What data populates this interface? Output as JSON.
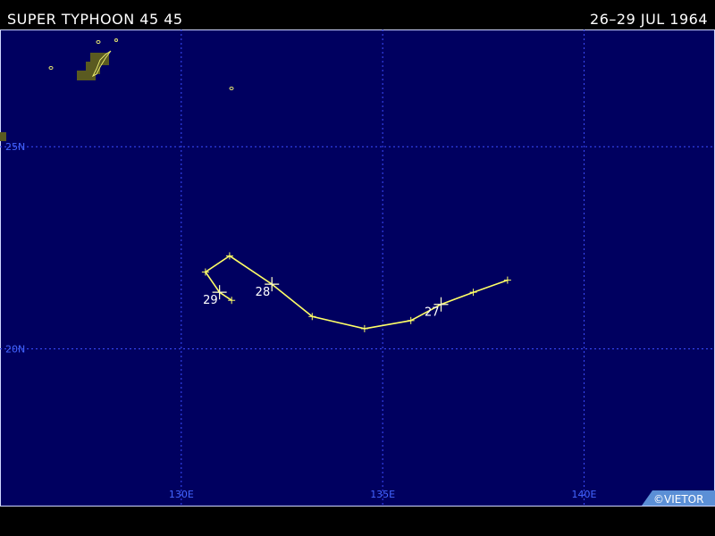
{
  "header": {
    "title": "SUPER TYPHOON 45 45",
    "date_range": "26–29 JUL 1964"
  },
  "map": {
    "background_color": "#000060",
    "grid_color": "#3b4cff",
    "track_color": "#ffff66",
    "land_color": "#5a5a20",
    "lat_range": [
      16.1,
      27.9
    ],
    "lon_range": [
      125.5,
      143.25
    ],
    "meridians": [
      {
        "lon": 130,
        "label": "130E"
      },
      {
        "lon": 135,
        "label": "135E"
      },
      {
        "lon": 140,
        "label": "140E"
      }
    ],
    "parallels": [
      {
        "lat": 25,
        "label": "25N"
      },
      {
        "lat": 20,
        "label": "20N"
      }
    ],
    "track": [
      {
        "lon": 138.1,
        "lat": 21.7
      },
      {
        "lon": 137.25,
        "lat": 21.4
      },
      {
        "lon": 136.45,
        "lat": 21.1
      },
      {
        "lon": 135.7,
        "lat": 20.7
      },
      {
        "lon": 134.55,
        "lat": 20.5
      },
      {
        "lon": 133.25,
        "lat": 20.8
      },
      {
        "lon": 132.25,
        "lat": 21.6
      },
      {
        "lon": 131.2,
        "lat": 22.3
      },
      {
        "lon": 130.6,
        "lat": 21.9
      },
      {
        "lon": 130.95,
        "lat": 21.4
      },
      {
        "lon": 131.25,
        "lat": 21.2
      }
    ],
    "day_markers": [
      {
        "lon": 136.45,
        "lat": 21.1,
        "label": "27"
      },
      {
        "lon": 132.25,
        "lat": 21.6,
        "label": "28"
      },
      {
        "lon": 130.95,
        "lat": 21.4,
        "label": "29"
      }
    ],
    "credit": "©VIETOR"
  }
}
